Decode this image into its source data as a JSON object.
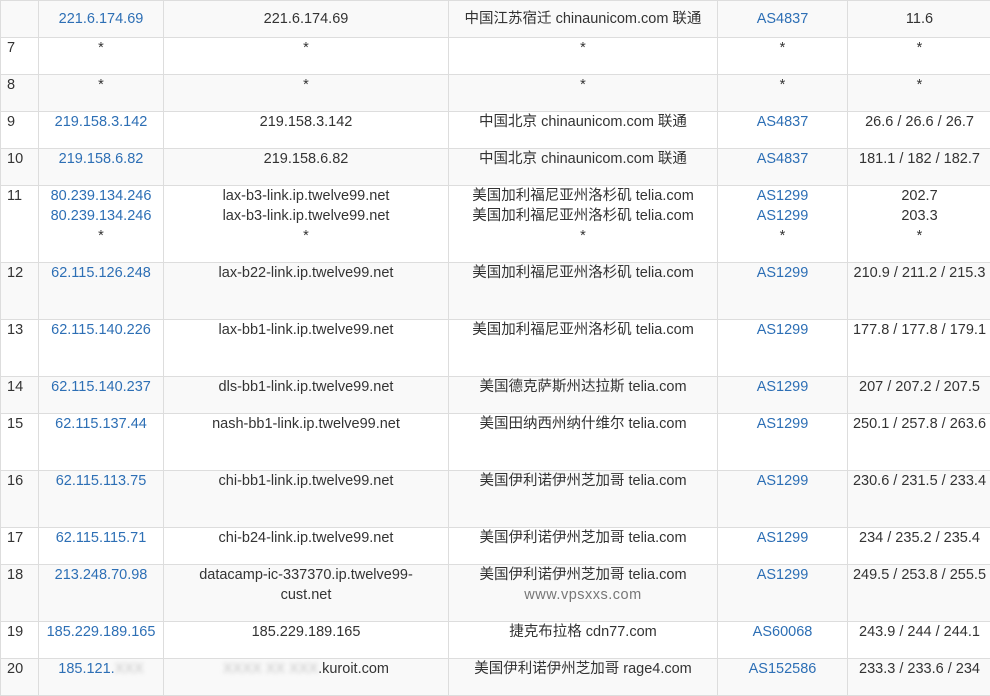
{
  "rows": [
    {
      "hop": "",
      "ip": [
        "221.6.174.69"
      ],
      "host": [
        "221.6.174.69"
      ],
      "loc": [
        "中国江苏宿迁 chinaunicom.com 联通"
      ],
      "as": [
        "AS4837"
      ],
      "rtt": [
        "11.6"
      ],
      "h": 37
    },
    {
      "hop": "7",
      "ip": [
        "*"
      ],
      "host": [
        "*"
      ],
      "loc": [
        "*"
      ],
      "as": [
        "*"
      ],
      "rtt": [
        "*"
      ],
      "h": 37
    },
    {
      "hop": "8",
      "ip": [
        "*"
      ],
      "host": [
        "*"
      ],
      "loc": [
        "*"
      ],
      "as": [
        "*"
      ],
      "rtt": [
        "*"
      ],
      "h": 37
    },
    {
      "hop": "9",
      "ip": [
        "219.158.3.142"
      ],
      "host": [
        "219.158.3.142"
      ],
      "loc": [
        "中国北京 chinaunicom.com 联通"
      ],
      "as": [
        "AS4837"
      ],
      "rtt": [
        "26.6 / 26.6 / 26.7"
      ],
      "h": 37
    },
    {
      "hop": "10",
      "ip": [
        "219.158.6.82"
      ],
      "host": [
        "219.158.6.82"
      ],
      "loc": [
        "中国北京 chinaunicom.com 联通"
      ],
      "as": [
        "AS4837"
      ],
      "rtt": [
        "181.1 / 182 / 182.7"
      ],
      "h": 37
    },
    {
      "hop": "11",
      "ip": [
        "80.239.134.246",
        "80.239.134.246",
        "*"
      ],
      "host": [
        "lax-b3-link.ip.twelve99.net",
        "lax-b3-link.ip.twelve99.net",
        "*"
      ],
      "loc": [
        "美国加利福尼亚州洛杉矶 telia.com",
        "美国加利福尼亚州洛杉矶 telia.com",
        "*"
      ],
      "as": [
        "AS1299",
        "AS1299",
        "*"
      ],
      "rtt": [
        "202.7",
        "203.3",
        "*"
      ],
      "h": 77
    },
    {
      "hop": "12",
      "ip": [
        "62.115.126.248"
      ],
      "host": [
        "lax-b22-link.ip.twelve99.net"
      ],
      "loc": [
        "美国加利福尼亚州洛杉矶 telia.com"
      ],
      "as": [
        "AS1299"
      ],
      "rtt": [
        "210.9 / 211.2 / 215.3"
      ],
      "wrapRtt": true,
      "h": 57
    },
    {
      "hop": "13",
      "ip": [
        "62.115.140.226"
      ],
      "host": [
        "lax-bb1-link.ip.twelve99.net"
      ],
      "loc": [
        "美国加利福尼亚州洛杉矶 telia.com"
      ],
      "as": [
        "AS1299"
      ],
      "rtt": [
        "177.8 / 177.8 / 179.1"
      ],
      "wrapRtt": true,
      "h": 57
    },
    {
      "hop": "14",
      "ip": [
        "62.115.140.237"
      ],
      "host": [
        "dls-bb1-link.ip.twelve99.net"
      ],
      "loc": [
        "美国德克萨斯州达拉斯 telia.com"
      ],
      "as": [
        "AS1299"
      ],
      "rtt": [
        "207 / 207.2 / 207.5"
      ],
      "h": 37
    },
    {
      "hop": "15",
      "ip": [
        "62.115.137.44"
      ],
      "host": [
        "nash-bb1-link.ip.twelve99.net"
      ],
      "loc": [
        "美国田纳西州纳什维尔 telia.com"
      ],
      "as": [
        "AS1299"
      ],
      "rtt": [
        "250.1 / 257.8 / 263.6"
      ],
      "wrapRtt": true,
      "h": 57
    },
    {
      "hop": "16",
      "ip": [
        "62.115.113.75"
      ],
      "host": [
        "chi-bb1-link.ip.twelve99.net"
      ],
      "loc": [
        "美国伊利诺伊州芝加哥 telia.com"
      ],
      "as": [
        "AS1299"
      ],
      "rtt": [
        "230.6 / 231.5 / 233.4"
      ],
      "wrapRtt": true,
      "h": 57
    },
    {
      "hop": "17",
      "ip": [
        "62.115.115.71"
      ],
      "host": [
        "chi-b24-link.ip.twelve99.net"
      ],
      "loc": [
        "美国伊利诺伊州芝加哥 telia.com"
      ],
      "as": [
        "AS1299"
      ],
      "rtt": [
        "234 / 235.2 / 235.4"
      ],
      "h": 37
    },
    {
      "hop": "18",
      "ip": [
        "213.248.70.98"
      ],
      "host": [
        "datacamp-ic-337370.ip.twelve99-",
        "cust.net"
      ],
      "loc": [
        "美国伊利诺伊州芝加哥 telia.com"
      ],
      "as": [
        "AS1299"
      ],
      "rtt": [
        "249.5 / 253.8 / 255.5"
      ],
      "wrapRtt": true,
      "h": 57,
      "watermark": "www.vpsxxs.com"
    },
    {
      "hop": "19",
      "ip": [
        "185.229.189.165"
      ],
      "host": [
        "185.229.189.165"
      ],
      "loc": [
        "捷克布拉格 cdn77.com"
      ],
      "as": [
        "AS60068"
      ],
      "rtt": [
        "243.9 / 244 / 244.1"
      ],
      "h": 37
    },
    {
      "hop": "20",
      "ip": [
        "185.121."
      ],
      "ipBlur": "XXX",
      "host": [
        ".kuroit.com"
      ],
      "hostBlur": "XXXX XX XXX",
      "loc": [
        "美国伊利诺伊州芝加哥 rage4.com"
      ],
      "as": [
        "AS152586"
      ],
      "rtt": [
        "233.3 / 233.6 / 234"
      ],
      "h": 37
    }
  ]
}
